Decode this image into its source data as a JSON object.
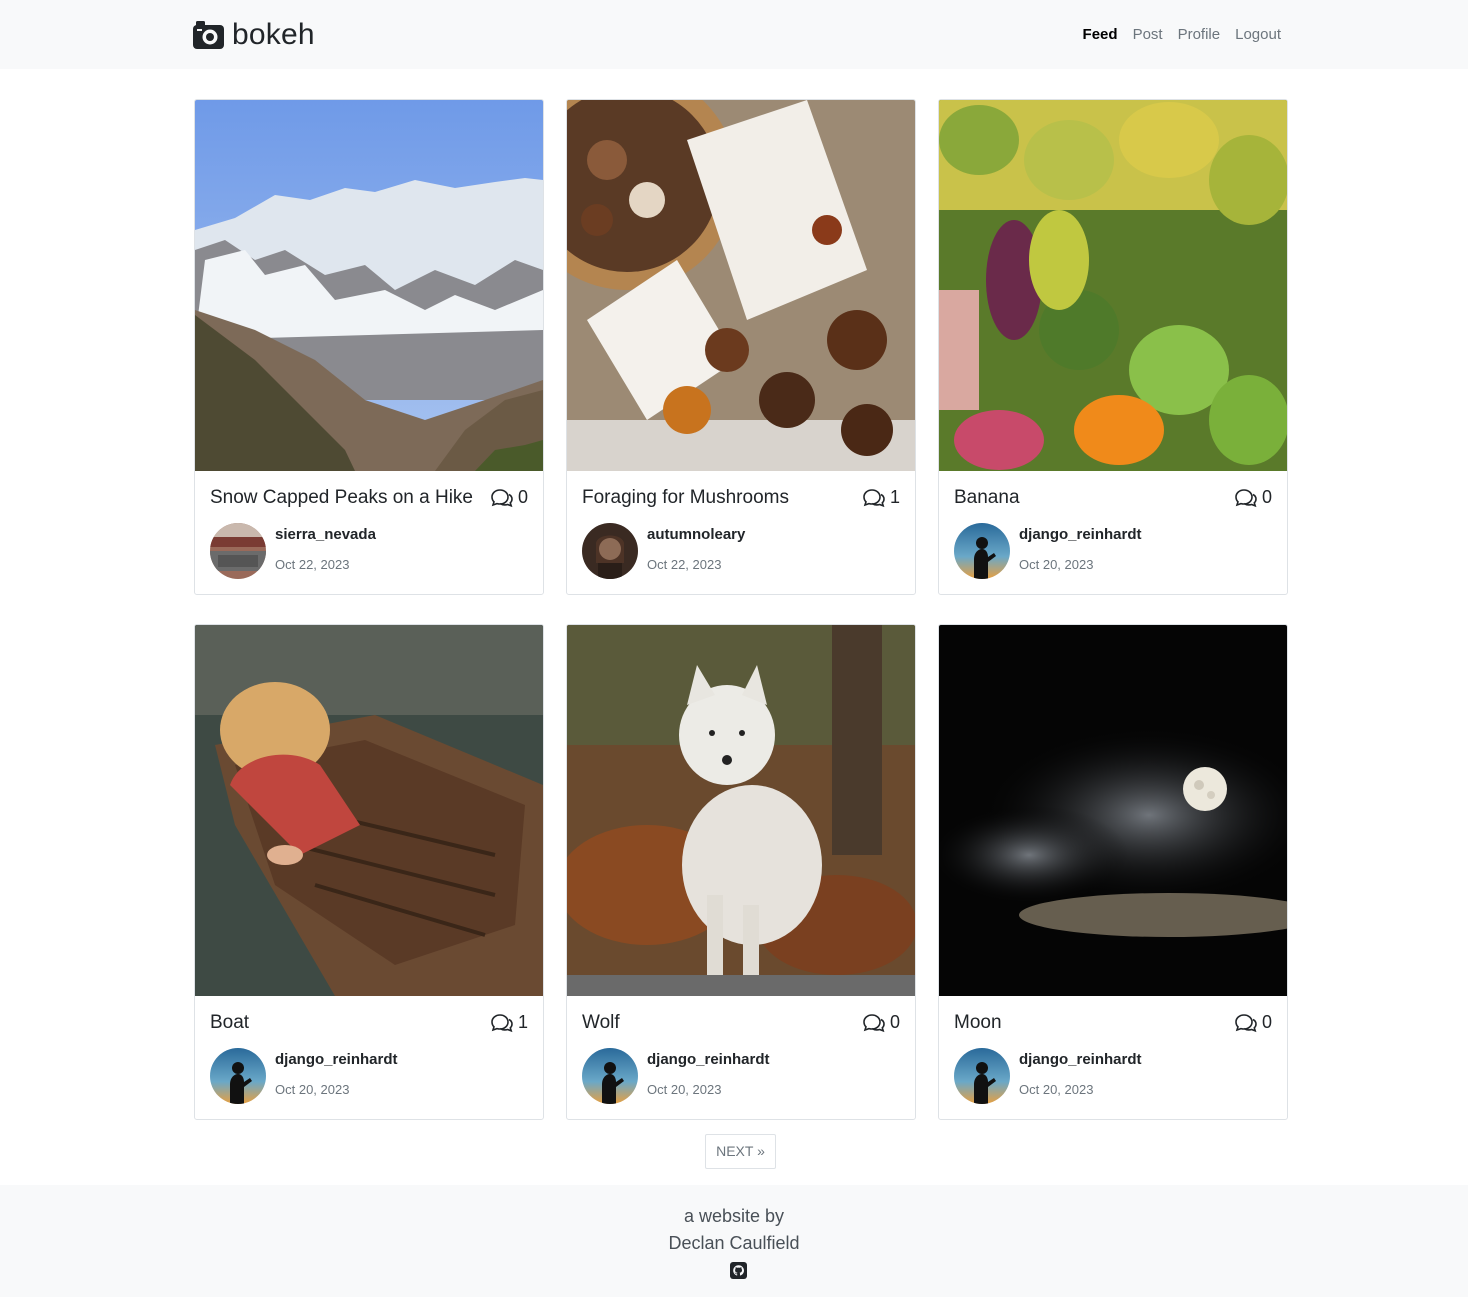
{
  "brand": {
    "name": "bokeh",
    "icon": "camera-icon"
  },
  "nav": {
    "feed": "Feed",
    "post": "Post",
    "profile": "Profile",
    "logout": "Logout"
  },
  "posts": [
    {
      "title": "Snow Capped Peaks on a Hike",
      "comments": "0",
      "username": "sierra_nevada",
      "date": "Oct 22, 2023",
      "image": "snowy-mountain-photo"
    },
    {
      "title": "Foraging for Mushrooms",
      "comments": "1",
      "username": "autumnoleary",
      "date": "Oct 22, 2023",
      "image": "mushrooms-photo"
    },
    {
      "title": "Banana",
      "comments": "0",
      "username": "django_reinhardt",
      "date": "Oct 20, 2023",
      "image": "fruit-market-photo"
    },
    {
      "title": "Boat",
      "comments": "1",
      "username": "django_reinhardt",
      "date": "Oct 20, 2023",
      "image": "boat-photo"
    },
    {
      "title": "Wolf",
      "comments": "0",
      "username": "django_reinhardt",
      "date": "Oct 20, 2023",
      "image": "wolf-photo"
    },
    {
      "title": "Moon",
      "comments": "0",
      "username": "django_reinhardt",
      "date": "Oct 20, 2023",
      "image": "moon-photo"
    }
  ],
  "pagination": {
    "next": "NEXT »"
  },
  "footer": {
    "line1": "a website by",
    "line2": "Declan Caulfield",
    "icon": "github-icon"
  }
}
